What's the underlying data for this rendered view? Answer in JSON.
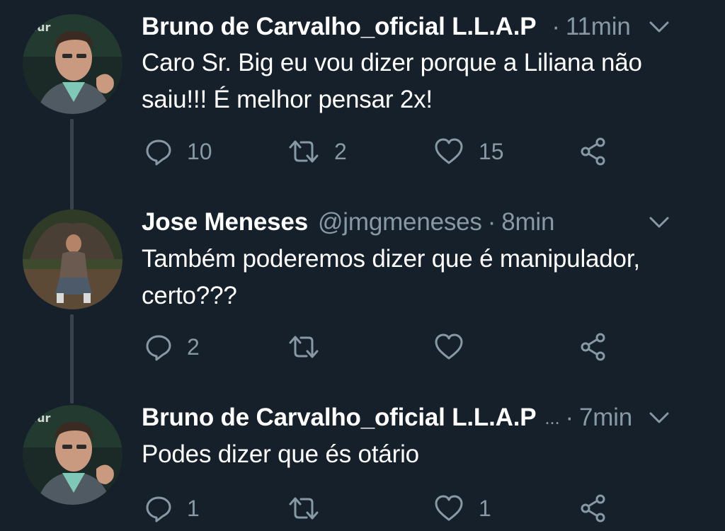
{
  "colors": {
    "background": "#15202b",
    "text_primary": "#ffffff",
    "text_secondary": "#8899a6",
    "thread_line": "#38444d"
  },
  "tweets": [
    {
      "author": "Bruno de Carvalho_oficial L.L.A.P",
      "handle": "",
      "ellipsis": "",
      "separator": "·",
      "time": "11min",
      "text": "Caro Sr. Big eu vou dizer porque a Liliana não saiu!!! É melhor pensar 2x!",
      "replies": "10",
      "retweets": "2",
      "likes": "15",
      "avatar_icon": "man-with-microphone-avatar"
    },
    {
      "author": "Jose Meneses",
      "handle": "@jmgmeneses",
      "ellipsis": "",
      "separator": "·",
      "time": "8min",
      "text": "Também poderemos dizer que é manipulador, certo???",
      "replies": "2",
      "retweets": "",
      "likes": "",
      "avatar_icon": "man-outdoors-avatar"
    },
    {
      "author": "Bruno de Carvalho_oficial L.L.A.P",
      "handle": "",
      "ellipsis": "...",
      "separator": "·",
      "time": "7min",
      "text": "Podes dizer que és otário",
      "replies": "1",
      "retweets": "",
      "likes": "1",
      "avatar_icon": "man-with-microphone-avatar"
    }
  ],
  "icons": {
    "reply": "reply-icon",
    "retweet": "retweet-icon",
    "like": "heart-icon",
    "share": "share-icon",
    "more": "chevron-down-icon"
  }
}
